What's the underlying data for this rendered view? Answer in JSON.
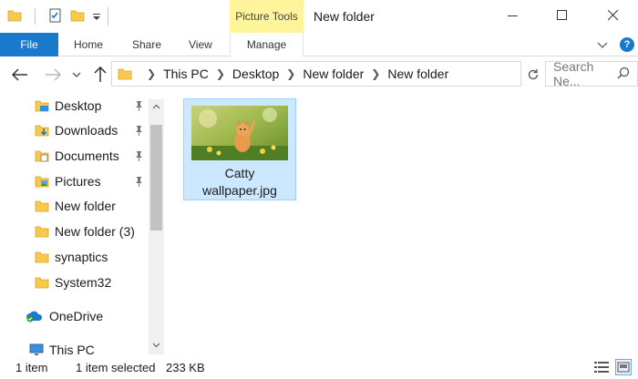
{
  "window": {
    "title": "New folder",
    "context_tab_group": "Picture Tools"
  },
  "ribbon": {
    "tabs": [
      {
        "label": "File"
      },
      {
        "label": "Home"
      },
      {
        "label": "Share"
      },
      {
        "label": "View"
      },
      {
        "label": "Manage"
      }
    ],
    "help_label": "?"
  },
  "addressbar": {
    "breadcrumbs": [
      "This PC",
      "Desktop",
      "New folder",
      "New folder"
    ],
    "search_placeholder": "Search Ne..."
  },
  "navigation": {
    "quick_access": [
      {
        "label": "Desktop",
        "icon": "desktop-folder-icon",
        "pinned": true
      },
      {
        "label": "Downloads",
        "icon": "downloads-folder-icon",
        "pinned": true
      },
      {
        "label": "Documents",
        "icon": "documents-folder-icon",
        "pinned": true
      },
      {
        "label": "Pictures",
        "icon": "pictures-folder-icon",
        "pinned": true
      },
      {
        "label": "New folder",
        "icon": "folder-icon",
        "pinned": false
      },
      {
        "label": "New folder (3)",
        "icon": "folder-icon",
        "pinned": false
      },
      {
        "label": "synaptics",
        "icon": "folder-icon",
        "pinned": false
      },
      {
        "label": "System32",
        "icon": "folder-icon",
        "pinned": false
      }
    ],
    "onedrive": "OneDrive",
    "this_pc": "This PC"
  },
  "content": {
    "files": [
      {
        "name_line1": "Catty",
        "name_line2": "wallpaper.jpg",
        "selected": true,
        "icon": "cat-image-thumbnail"
      }
    ]
  },
  "status": {
    "item_count": "1 item",
    "selection": "1 item selected",
    "size": "233 KB"
  },
  "colors": {
    "file_tab": "#1979ca",
    "picture_tools": "#fdf49c",
    "selection_fill": "#cce8ff",
    "selection_border": "#99d1ff",
    "folder_yellow": "#f8c94a"
  }
}
